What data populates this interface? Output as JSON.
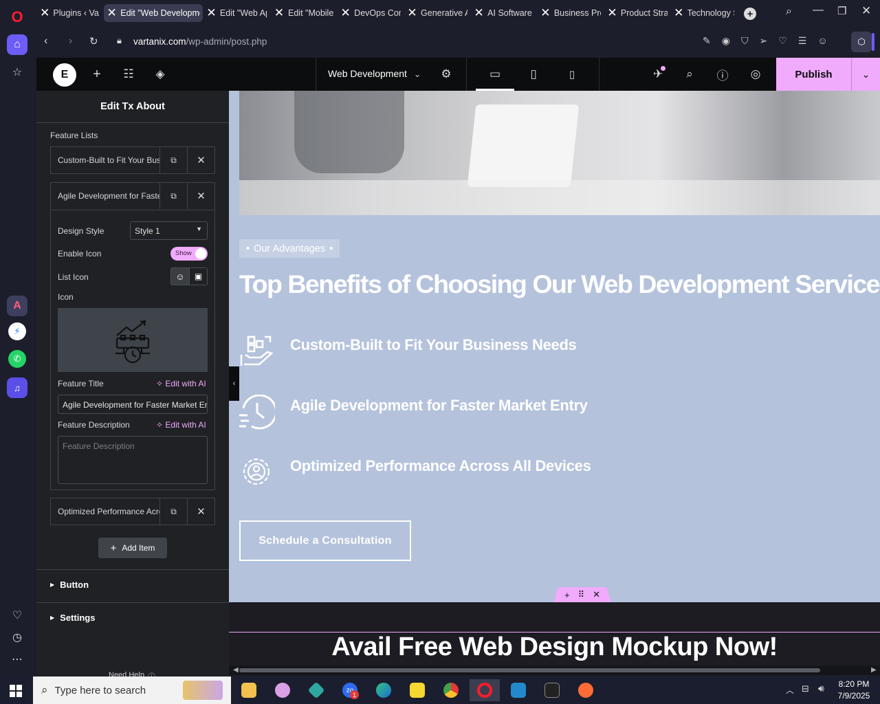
{
  "browser": {
    "tabs": [
      {
        "label": "Plugins ‹ Vart"
      },
      {
        "label": "Edit \"Web Developme"
      },
      {
        "label": "Edit \"Web Ap"
      },
      {
        "label": "Edit \"Mobile"
      },
      {
        "label": "DevOps Con"
      },
      {
        "label": "Generative A"
      },
      {
        "label": "AI Software I"
      },
      {
        "label": "Business Pro"
      },
      {
        "label": "Product Strat"
      },
      {
        "label": "Technology S"
      }
    ],
    "url_domain": "vartanix.com",
    "url_path": "/wp-admin/post.php"
  },
  "editor": {
    "page_name": "Web Development",
    "publish_label": "Publish"
  },
  "panel": {
    "title": "Edit Tx About",
    "section_label": "Feature Lists",
    "items": [
      {
        "label": "Custom-Built to Fit Your Business Needs"
      },
      {
        "label": "Agile Development for Faster Market Entry"
      },
      {
        "label": "Optimized Performance Across All Devices"
      }
    ],
    "design_style_label": "Design Style",
    "design_style_value": "Style 1",
    "enable_icon_label": "Enable Icon",
    "enable_icon_toggle": "Show",
    "list_icon_label": "List Icon",
    "icon_label": "Icon",
    "feature_title_label": "Feature Title",
    "edit_ai_label": "Edit with AI",
    "feature_title_value": "Agile Development for Faster Market Entry",
    "feature_desc_label": "Feature Description",
    "feature_desc_placeholder": "Feature Description",
    "add_item_label": "Add Item",
    "button_section": "Button",
    "settings_section": "Settings",
    "need_help": "Need Help"
  },
  "preview": {
    "tag": "Our Advantages",
    "heading": "Top Benefits of Choosing Our Web Development Services",
    "features": [
      {
        "title": "Custom-Built to Fit Your Business Needs",
        "icon": "puzzle-hand-icon"
      },
      {
        "title": "Agile Development for Faster Market Entry",
        "icon": "fast-clock-icon"
      },
      {
        "title": "Optimized Performance Across All Devices",
        "icon": "gear-person-icon"
      }
    ],
    "cta": "Schedule a Consultation",
    "footer_heading": "Avail Free Web Design Mockup Now!"
  },
  "taskbar": {
    "search_placeholder": "Type here to search",
    "time": "8:20 PM",
    "date": "7/9/2025",
    "zoom_badge": "1"
  },
  "colors": {
    "accent": "#f0abfc",
    "preview_bg": "#b4c2dc",
    "panel_bg": "#1f2124"
  }
}
